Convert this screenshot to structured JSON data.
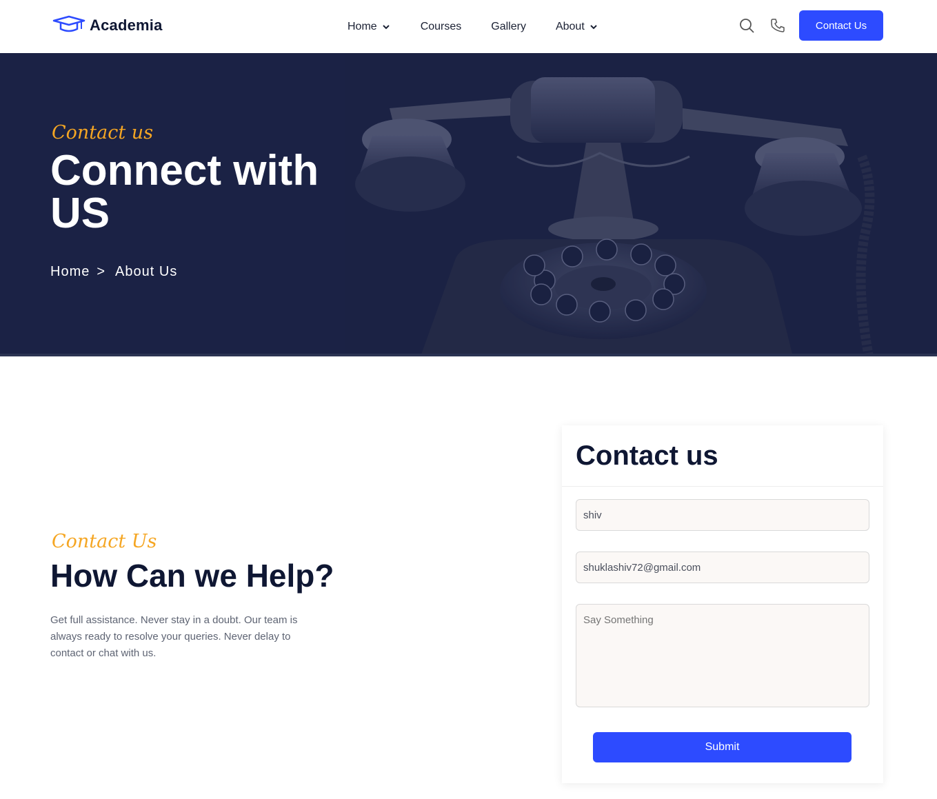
{
  "header": {
    "logo_text": "Academia",
    "nav": [
      {
        "label": "Home",
        "has_dropdown": true
      },
      {
        "label": "Courses",
        "has_dropdown": false
      },
      {
        "label": "Gallery",
        "has_dropdown": false
      },
      {
        "label": "About",
        "has_dropdown": true
      }
    ],
    "icons": [
      "search-icon",
      "phone-icon"
    ],
    "contact_button": "Contact Us"
  },
  "hero": {
    "subtitle": "Contact us",
    "title": "Connect with US",
    "breadcrumb": [
      "Home",
      "About Us"
    ],
    "breadcrumb_separator": ">"
  },
  "help": {
    "subtitle": "Contact Us",
    "title": "How Can we Help?",
    "text": "Get full assistance. Never stay in a doubt. Our team is always ready to resolve your queries. Never delay to contact or chat with us."
  },
  "form": {
    "title": "Contact us",
    "name_value": "shiv",
    "email_value": "shuklashiv72@gmail.com",
    "message_placeholder": "Say Something",
    "submit_label": "Submit"
  },
  "colors": {
    "accent": "#2d4bff",
    "hero_bg": "#1b2245",
    "script_orange": "#f5a623",
    "heading": "#0f1733"
  }
}
